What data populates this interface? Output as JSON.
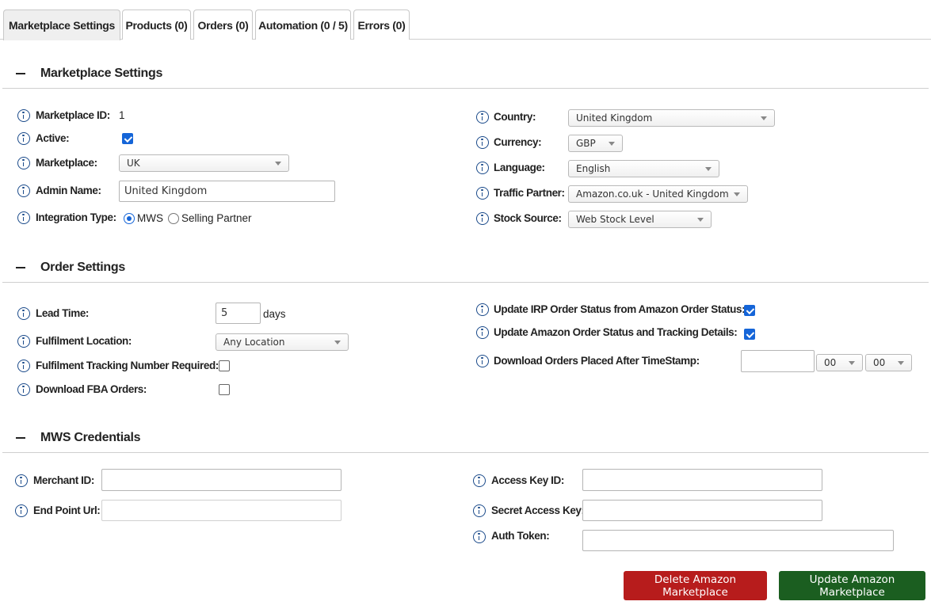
{
  "tabs": [
    {
      "label": "Marketplace Settings",
      "active": true
    },
    {
      "label": "Products (0)",
      "active": false
    },
    {
      "label": "Orders (0)",
      "active": false
    },
    {
      "label": "Automation (0 / 5)",
      "active": false
    },
    {
      "label": "Errors (0)",
      "active": false
    }
  ],
  "marketplace_settings": {
    "title": "Marketplace Settings",
    "marketplace_id": {
      "label": "Marketplace ID:",
      "value": "1"
    },
    "active": {
      "label": "Active:",
      "checked": true
    },
    "marketplace": {
      "label": "Marketplace:",
      "value": "UK"
    },
    "admin_name": {
      "label": "Admin Name:",
      "value": "United Kingdom"
    },
    "integration_type": {
      "label": "Integration Type:",
      "options": [
        {
          "label": "MWS",
          "selected": true
        },
        {
          "label": "Selling Partner",
          "selected": false
        }
      ]
    },
    "country": {
      "label": "Country:",
      "value": "United Kingdom"
    },
    "currency": {
      "label": "Currency:",
      "value": "GBP"
    },
    "language": {
      "label": "Language:",
      "value": "English"
    },
    "traffic_partner": {
      "label": "Traffic Partner:",
      "value": "Amazon.co.uk - United Kingdom"
    },
    "stock_source": {
      "label": "Stock Source:",
      "value": "Web Stock Level"
    }
  },
  "order_settings": {
    "title": "Order Settings",
    "lead_time": {
      "label": "Lead Time:",
      "value": "5",
      "unit": "days"
    },
    "fulfilment_location": {
      "label": "Fulfilment Location:",
      "value": "Any Location"
    },
    "tracking_required": {
      "label": "Fulfilment Tracking Number Required:",
      "checked": false
    },
    "download_fba": {
      "label": "Download FBA Orders:",
      "checked": false
    },
    "update_irp_status": {
      "label": "Update IRP Order Status from Amazon Order Status:",
      "checked": true
    },
    "update_amazon_status": {
      "label": "Update Amazon Order Status and Tracking Details:",
      "checked": true
    },
    "download_after_timestamp": {
      "label": "Download Orders Placed After TimeStamp:",
      "date_value": "",
      "hour": "00",
      "minute": "00"
    }
  },
  "mws_credentials": {
    "title": "MWS Credentials",
    "merchant_id": {
      "label": "Merchant ID:",
      "value": ""
    },
    "end_point_url": {
      "label": "End Point Url:",
      "value": ""
    },
    "access_key_id": {
      "label": "Access Key ID:",
      "value": ""
    },
    "secret_access_key": {
      "label": "Secret Access Key:",
      "value": ""
    },
    "auth_token": {
      "label": "Auth Token:",
      "value": ""
    }
  },
  "actions": {
    "delete_label": "Delete Amazon Marketplace",
    "update_label": "Update Amazon Marketplace"
  },
  "colors": {
    "accent": "#1565d8",
    "info_icon": "#1a4a8a",
    "delete_button": "#b71c1c",
    "update_button": "#1b5e20"
  }
}
